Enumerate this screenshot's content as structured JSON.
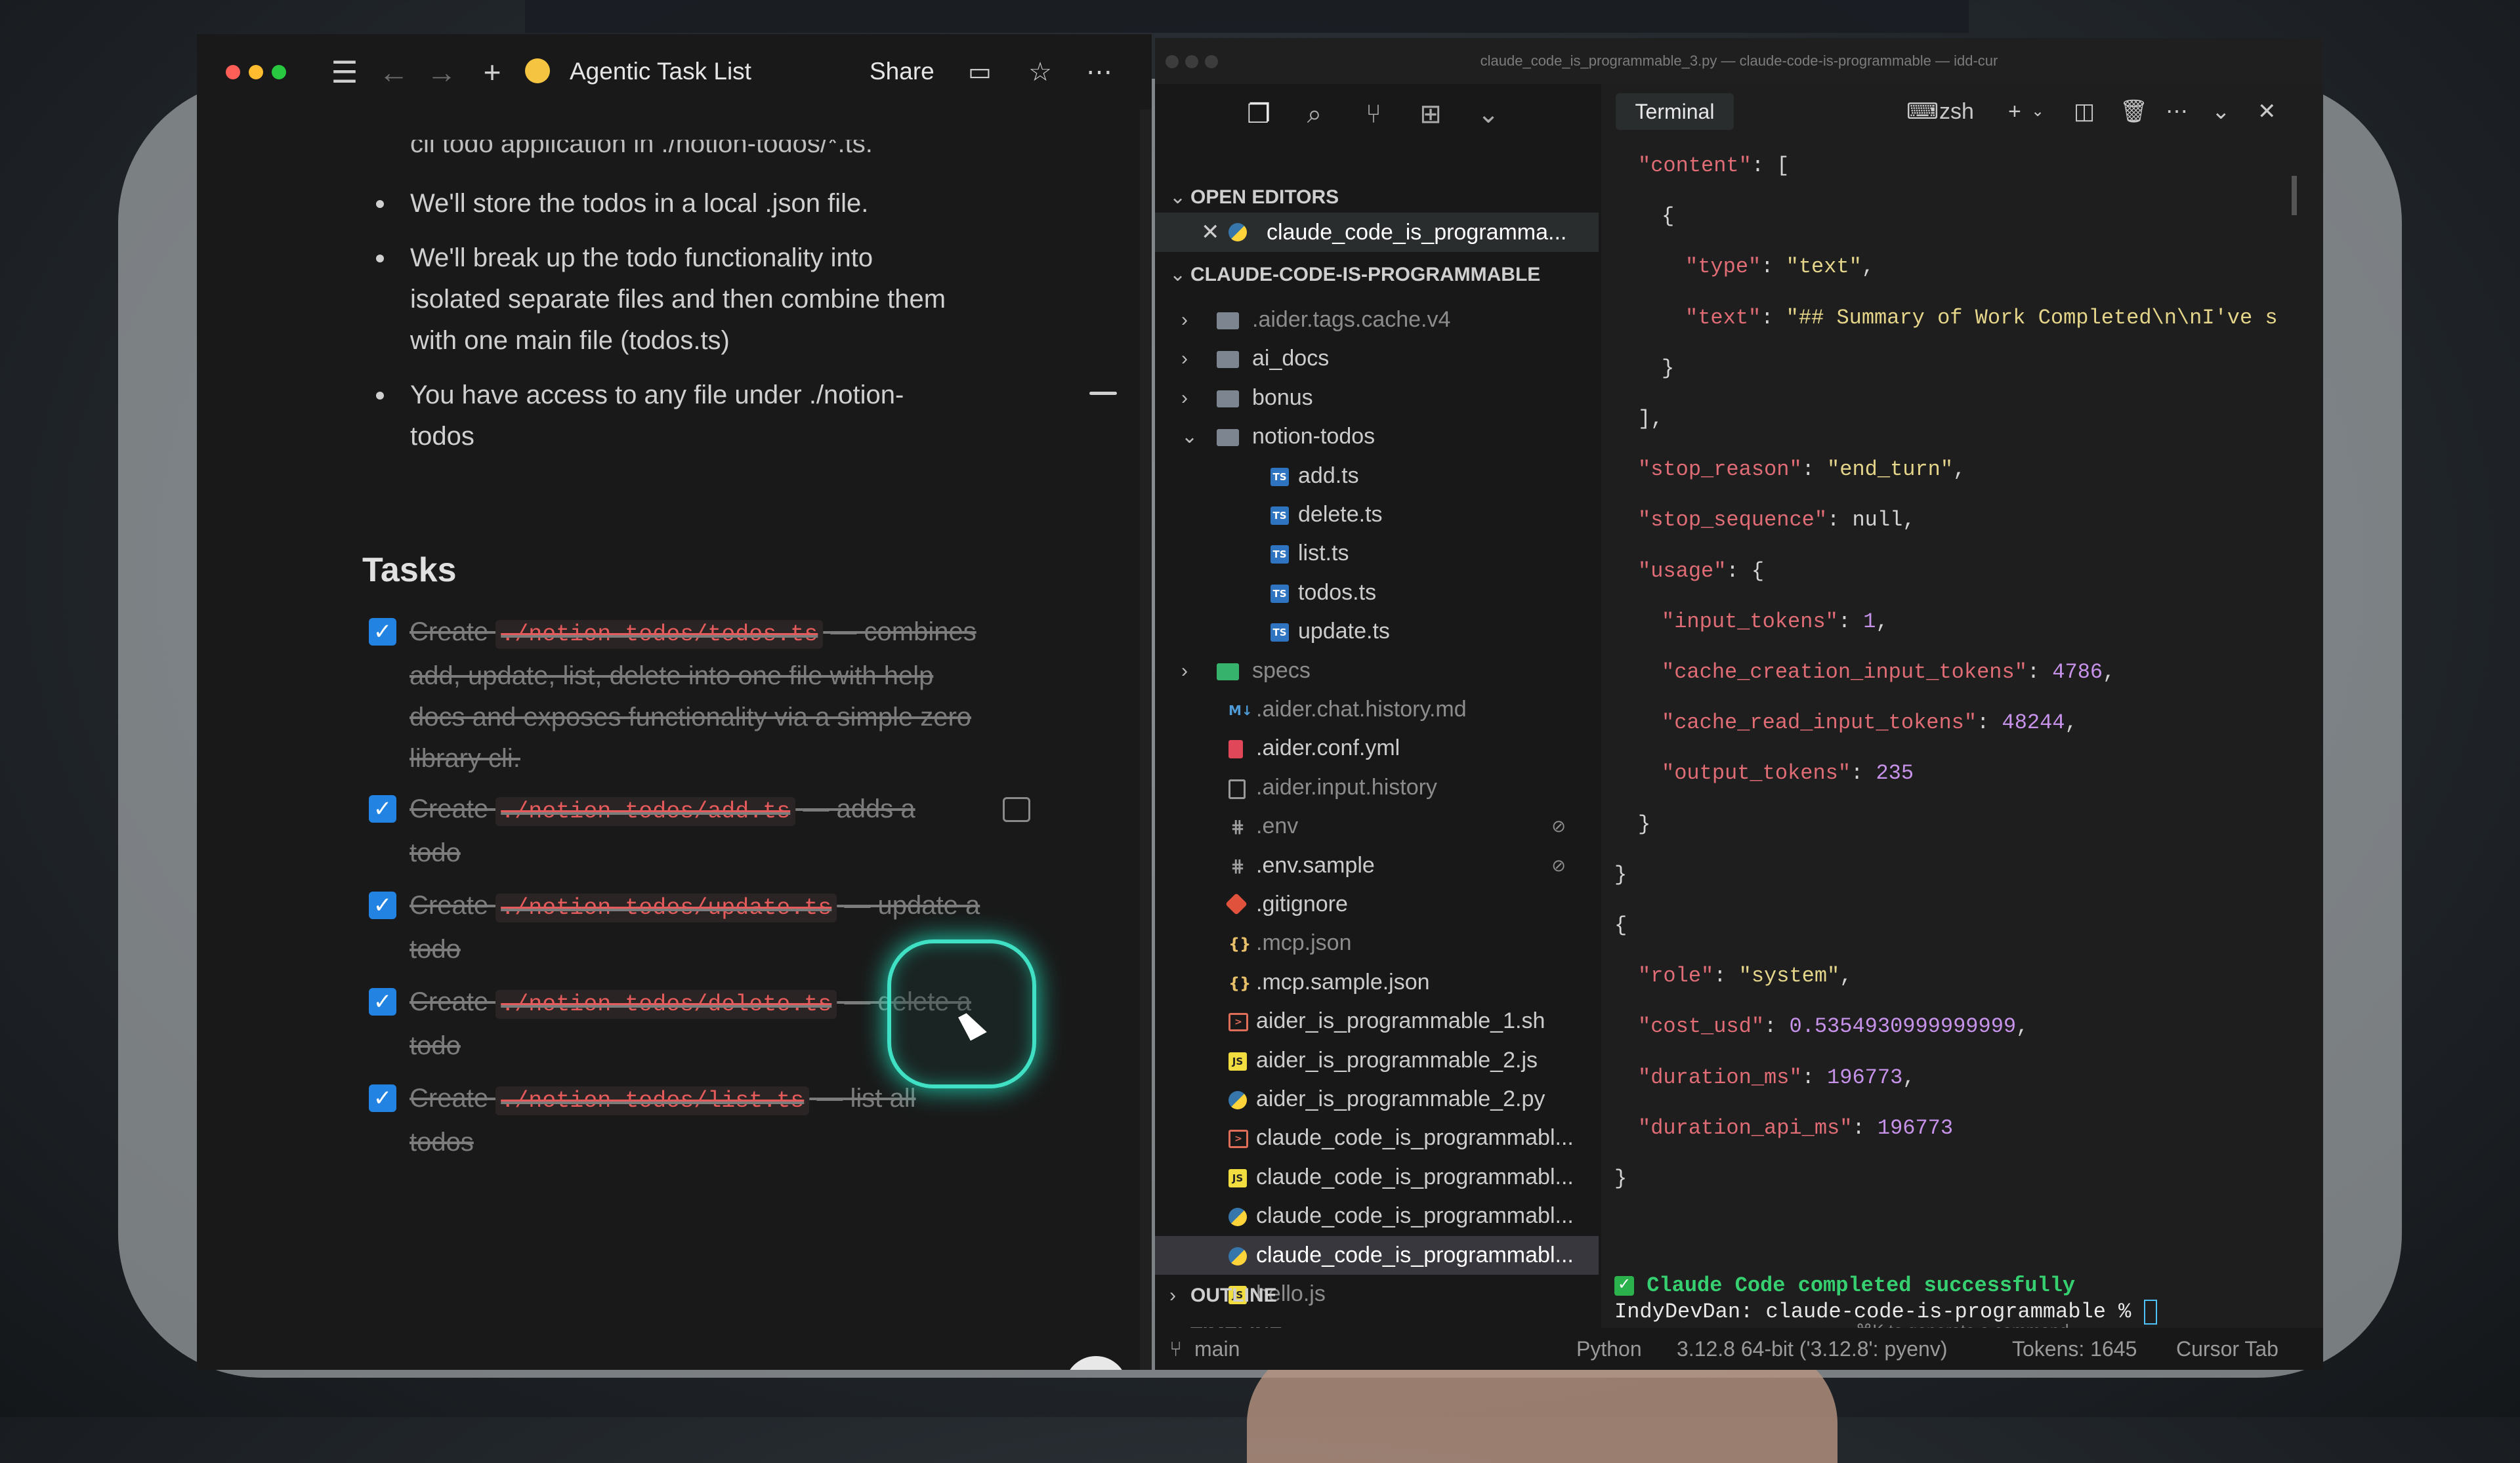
{
  "notion": {
    "title": "Agentic Task List",
    "share_label": "Share",
    "partial_top_text": "cli todo application in ./notion-todos/*.ts.",
    "bullets": [
      "We'll store the todos in a local .json file.",
      "We'll break up the todo functionality into isolated separate files and then combine them with one main file (todos.ts)",
      "You have access to any file under ./notion-todos"
    ],
    "tasks_heading": "Tasks",
    "tasks": [
      {
        "prefix": "Create",
        "code": "./notion-todos/todos.ts",
        "suffix": "— combines add, update, list, delete into one file with help docs and exposes functionality via a simple zero library cli.",
        "checked": true
      },
      {
        "prefix": "Create",
        "code": "./notion-todos/add.ts",
        "suffix": "— adds a todo",
        "checked": true
      },
      {
        "prefix": "Create",
        "code": "./notion-todos/update.ts",
        "suffix": "— update a todo",
        "checked": true
      },
      {
        "prefix": "Create",
        "code": "./notion-todos/delete.ts",
        "suffix": "— delete a todo",
        "checked": true
      },
      {
        "prefix": "Create",
        "code": "./notion-todos/list.ts",
        "suffix": "— list all todos",
        "checked": true
      }
    ],
    "help_button": "?"
  },
  "vscode": {
    "window_title": "claude_code_is_programmable_3.py — claude-code-is-programmable — idd-cur",
    "sections": {
      "open_editors": "OPEN EDITORS",
      "project": "CLAUDE-CODE-IS-PROGRAMMABLE",
      "outline": "OUTLINE",
      "timeline": "TIMELINE"
    },
    "open_editor_file": "claude_code_is_programma...",
    "tree": [
      {
        "name": ".aider.tags.cache.v4",
        "type": "folder",
        "depth": 0,
        "expanded": false,
        "dim": true
      },
      {
        "name": "ai_docs",
        "type": "folder",
        "depth": 0,
        "expanded": false,
        "dim": false
      },
      {
        "name": "bonus",
        "type": "folder",
        "depth": 0,
        "expanded": false,
        "dim": false
      },
      {
        "name": "notion-todos",
        "type": "folder",
        "depth": 0,
        "expanded": true,
        "dim": false
      },
      {
        "name": "add.ts",
        "type": "ts",
        "depth": 1
      },
      {
        "name": "delete.ts",
        "type": "ts",
        "depth": 1
      },
      {
        "name": "list.ts",
        "type": "ts",
        "depth": 1
      },
      {
        "name": "todos.ts",
        "type": "ts",
        "depth": 1
      },
      {
        "name": "update.ts",
        "type": "ts",
        "depth": 1
      },
      {
        "name": "specs",
        "type": "specs",
        "depth": 0,
        "expanded": false,
        "dim": true
      },
      {
        "name": ".aider.chat.history.md",
        "type": "md",
        "depth": 0,
        "dim": true
      },
      {
        "name": ".aider.conf.yml",
        "type": "yml",
        "depth": 0
      },
      {
        "name": ".aider.input.history",
        "type": "txt",
        "depth": 0,
        "dim": true
      },
      {
        "name": ".env",
        "type": "env",
        "depth": 0,
        "dim": true,
        "badge": "⊘"
      },
      {
        "name": ".env.sample",
        "type": "env",
        "depth": 0,
        "badge": "⊘"
      },
      {
        "name": ".gitignore",
        "type": "git",
        "depth": 0
      },
      {
        "name": ".mcp.json",
        "type": "json",
        "depth": 0,
        "dim": true
      },
      {
        "name": ".mcp.sample.json",
        "type": "json",
        "depth": 0
      },
      {
        "name": "aider_is_programmable_1.sh",
        "type": "sh",
        "depth": 0
      },
      {
        "name": "aider_is_programmable_2.js",
        "type": "js",
        "depth": 0
      },
      {
        "name": "aider_is_programmable_2.py",
        "type": "py",
        "depth": 0
      },
      {
        "name": "claude_code_is_programmabl...",
        "type": "sh",
        "depth": 0
      },
      {
        "name": "claude_code_is_programmabl...",
        "type": "js",
        "depth": 0
      },
      {
        "name": "claude_code_is_programmabl...",
        "type": "py",
        "depth": 0
      },
      {
        "name": "claude_code_is_programmabl...",
        "type": "py",
        "depth": 0,
        "selected": true
      },
      {
        "name": "hello.js",
        "type": "js",
        "depth": 0,
        "dim": true
      }
    ],
    "terminal": {
      "tab_label": "Terminal",
      "shell_label": "zsh",
      "lines": [
        {
          "indent": 1,
          "parts": [
            [
              "k",
              "\"content\""
            ],
            [
              "p",
              ": ["
            ]
          ]
        },
        {
          "indent": 2,
          "parts": [
            [
              "p",
              "{"
            ]
          ]
        },
        {
          "indent": 3,
          "parts": [
            [
              "k",
              "\"type\""
            ],
            [
              "p",
              ": "
            ],
            [
              "s",
              "\"text\""
            ],
            [
              "p",
              ","
            ]
          ]
        },
        {
          "indent": 3,
          "parts": [
            [
              "k",
              "\"text\""
            ],
            [
              "p",
              ": "
            ],
            [
              "s",
              "\"## Summary of Work Completed\\n\\nI've s"
            ]
          ]
        },
        {
          "indent": 2,
          "parts": [
            [
              "p",
              "}"
            ]
          ]
        },
        {
          "indent": 1,
          "parts": [
            [
              "p",
              "],"
            ]
          ]
        },
        {
          "indent": 1,
          "parts": [
            [
              "k",
              "\"stop_reason\""
            ],
            [
              "p",
              ": "
            ],
            [
              "s",
              "\"end_turn\""
            ],
            [
              "p",
              ","
            ]
          ]
        },
        {
          "indent": 1,
          "parts": [
            [
              "k",
              "\"stop_sequence\""
            ],
            [
              "p",
              ": null,"
            ]
          ]
        },
        {
          "indent": 1,
          "parts": [
            [
              "k",
              "\"usage\""
            ],
            [
              "p",
              ": {"
            ]
          ]
        },
        {
          "indent": 2,
          "parts": [
            [
              "k",
              "\"input_tokens\""
            ],
            [
              "p",
              ": "
            ],
            [
              "n",
              "1"
            ],
            [
              "p",
              ","
            ]
          ]
        },
        {
          "indent": 2,
          "parts": [
            [
              "k",
              "\"cache_creation_input_tokens\""
            ],
            [
              "p",
              ": "
            ],
            [
              "n",
              "4786"
            ],
            [
              "p",
              ","
            ]
          ]
        },
        {
          "indent": 2,
          "parts": [
            [
              "k",
              "\"cache_read_input_tokens\""
            ],
            [
              "p",
              ": "
            ],
            [
              "n",
              "48244"
            ],
            [
              "p",
              ","
            ]
          ]
        },
        {
          "indent": 2,
          "parts": [
            [
              "k",
              "\"output_tokens\""
            ],
            [
              "p",
              ": "
            ],
            [
              "n",
              "235"
            ]
          ]
        },
        {
          "indent": 1,
          "parts": [
            [
              "p",
              "}"
            ]
          ]
        },
        {
          "indent": 0,
          "parts": [
            [
              "p",
              "}"
            ]
          ]
        },
        {
          "indent": 0,
          "parts": [
            [
              "p",
              "{"
            ]
          ]
        },
        {
          "indent": 1,
          "parts": [
            [
              "k",
              "\"role\""
            ],
            [
              "p",
              ": "
            ],
            [
              "s",
              "\"system\""
            ],
            [
              "p",
              ","
            ]
          ]
        },
        {
          "indent": 1,
          "parts": [
            [
              "k",
              "\"cost_usd\""
            ],
            [
              "p",
              ": "
            ],
            [
              "n",
              "0.5354930999999999"
            ],
            [
              "p",
              ","
            ]
          ]
        },
        {
          "indent": 1,
          "parts": [
            [
              "k",
              "\"duration_ms\""
            ],
            [
              "p",
              ": "
            ],
            [
              "n",
              "196773"
            ],
            [
              "p",
              ","
            ]
          ]
        },
        {
          "indent": 1,
          "parts": [
            [
              "k",
              "\"duration_api_ms\""
            ],
            [
              "p",
              ": "
            ],
            [
              "n",
              "196773"
            ]
          ]
        },
        {
          "indent": 0,
          "parts": [
            [
              "p",
              "}"
            ]
          ]
        }
      ],
      "success_text": "Claude Code completed successfully",
      "prompt_text": "IndyDevDan: claude-code-is-programmable % ",
      "generate_hint": "⌘K to generate a command"
    },
    "status": {
      "branch": "main",
      "language": "Python",
      "interpreter": "3.12.8 64-bit ('3.12.8': pyenv)",
      "tokens": "Tokens: 1645",
      "cursor_tab": "Cursor Tab"
    }
  }
}
